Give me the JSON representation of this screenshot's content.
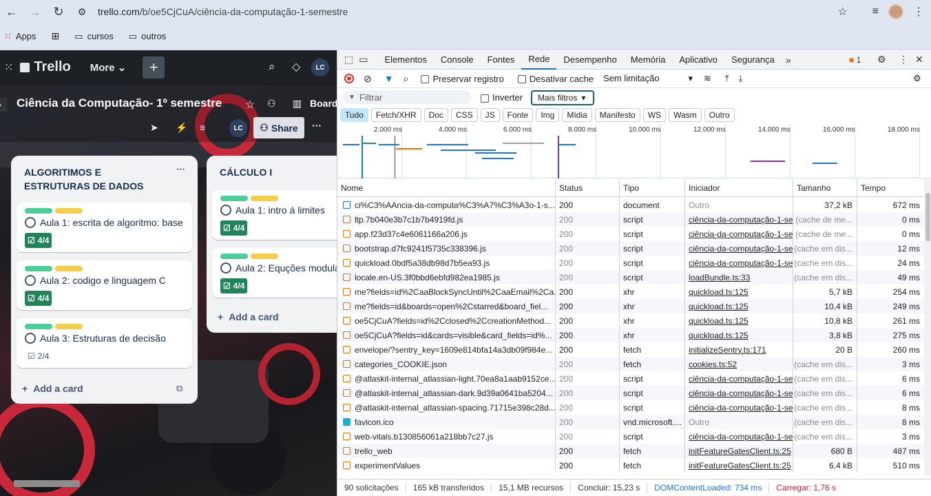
{
  "browser": {
    "url_host": "trello.com",
    "url_path": "/b/oe5CjCuA/ciência-da-computação-1-semestre",
    "bookmarks": [
      {
        "label": "Apps"
      },
      {
        "label": ""
      },
      {
        "label": "cursos"
      },
      {
        "label": "outros"
      }
    ]
  },
  "trello": {
    "brand": "Trello",
    "more": "More",
    "avatar": "LC",
    "board_title": "Ciência da Computação- 1º semestre",
    "board_view": "Board",
    "share": "Share",
    "lists": [
      {
        "title": "ALGORITIMOS E ESTRUTURAS DE DADOS",
        "add": "Add a card",
        "cards": [
          {
            "text": "Aula 1: escrita de algoritmo: base",
            "badge": "4/4",
            "complete": true
          },
          {
            "text": "Aula 2: codigo e linguagem C",
            "badge": "4/4",
            "complete": true
          },
          {
            "text": "Aula 3: Estruturas de decisão",
            "badge": "2/4",
            "complete": false
          }
        ]
      },
      {
        "title": "CÁLCULO I",
        "add": "Add a card",
        "cards": [
          {
            "text": "Aula 1: intro á limites",
            "badge": "4/4",
            "complete": true
          },
          {
            "text": "Aula 2: Equções modula",
            "badge": "4/4",
            "complete": true
          }
        ]
      }
    ],
    "colors": {
      "green_label": "#4bce97",
      "yellow_label": "#f5cd47",
      "badge_green": "#1f845a"
    }
  },
  "devtools": {
    "tabs": [
      "Elementos",
      "Console",
      "Fontes",
      "Rede",
      "Desempenho",
      "Memória",
      "Aplicativo",
      "Segurança"
    ],
    "active_tab": "Rede",
    "issues_count": "1",
    "toolbar": {
      "preserve": "Preservar registro",
      "disable_cache": "Desativar cache",
      "throttle": "Sem limitação"
    },
    "filter": {
      "placeholder": "Filtrar",
      "invert": "Inverter",
      "more_filters": "Mais filtros"
    },
    "types": [
      "Tudo",
      "Fetch/XHR",
      "Doc",
      "CSS",
      "JS",
      "Fonte",
      "Img",
      "Mídia",
      "Manifesto",
      "WS",
      "Wasm",
      "Outro"
    ],
    "timeline_labels": [
      "2.000 ms",
      "4.000 ms",
      "6.000 ms",
      "8.000 ms",
      "10.000 ms",
      "12.000 ms",
      "14.000 ms",
      "16.000 ms",
      "18.000 ms"
    ],
    "columns": [
      "Nome",
      "Status",
      "Tipo",
      "Iniciador",
      "Tamanho",
      "Tempo"
    ],
    "rows": [
      {
        "name": "ci%C3%AAncia-da-computa%C3%A7%C3%A3o-1-s...",
        "status": "200",
        "type": "document",
        "initiator": "Outro",
        "size": "37,2 kB",
        "time": "672 ms",
        "kind": "doc"
      },
      {
        "name": "ltp.7b040e3b7c1b7b4919fd.js",
        "status": "200",
        "type": "script",
        "initiator": "ciência-da-computação-1-se",
        "size": "(cache de me...",
        "time": "0 ms",
        "kind": "script"
      },
      {
        "name": "app.f23d37c4e6061166a206.js",
        "status": "200",
        "type": "script",
        "initiator": "ciência-da-computação-1-se",
        "size": "(cache de me...",
        "time": "0 ms",
        "kind": "script"
      },
      {
        "name": "bootstrap.d7fc9241f5735c338396.js",
        "status": "200",
        "type": "script",
        "initiator": "ciência-da-computação-1-se",
        "size": "(cache em dis...",
        "time": "12 ms",
        "kind": "script"
      },
      {
        "name": "quickload.0bdf5a38db98d7b5ea93.js",
        "status": "200",
        "type": "script",
        "initiator": "ciência-da-computação-1-se",
        "size": "(cache em dis...",
        "time": "24 ms",
        "kind": "script"
      },
      {
        "name": "locale.en-US.3f0bbd6ebfd982ea1985.js",
        "status": "200",
        "type": "script",
        "initiator": "loadBundle.ts:33",
        "size": "(cache em dis...",
        "time": "49 ms",
        "kind": "script"
      },
      {
        "name": "me?fields=id%2CaaBlockSyncUntil%2CaaEmail%2Ca...",
        "status": "200",
        "type": "xhr",
        "initiator": "quickload.ts:125",
        "size": "5,7 kB",
        "time": "254 ms",
        "kind": "xhr"
      },
      {
        "name": "me?fields=id&boards=open%2Cstarred&board_fiel...",
        "status": "200",
        "type": "xhr",
        "initiator": "quickload.ts:125",
        "size": "10,4 kB",
        "time": "249 ms",
        "kind": "xhr"
      },
      {
        "name": "oe5CjCuA?fields=id%2Cclosed%2CcreationMethod...",
        "status": "200",
        "type": "xhr",
        "initiator": "quickload.ts:125",
        "size": "10,8 kB",
        "time": "261 ms",
        "kind": "xhr"
      },
      {
        "name": "oe5CjCuA?fields=id&cards=visible&card_fields=id%...",
        "status": "200",
        "type": "xhr",
        "initiator": "quickload.ts:125",
        "size": "3,8 kB",
        "time": "275 ms",
        "kind": "xhr"
      },
      {
        "name": "envelope/?sentry_key=1609e814bfa14a3db09f984e...",
        "status": "200",
        "type": "fetch",
        "initiator": "initializeSentry.ts:171",
        "size": "20 B",
        "time": "260 ms",
        "kind": "xhr"
      },
      {
        "name": "categories_COOKIE.json",
        "status": "200",
        "type": "fetch",
        "initiator": "cookies.ts:52",
        "size": "(cache em dis...",
        "time": "3 ms",
        "kind": "xhr"
      },
      {
        "name": "@atlaskit-internal_atlassian-light.70ea8a1aab9152ce...",
        "status": "200",
        "type": "script",
        "initiator": "ciência-da-computação-1-se",
        "size": "(cache em dis...",
        "time": "6 ms",
        "kind": "script"
      },
      {
        "name": "@atlaskit-internal_atlassian-dark.9d39a0641ba5204...",
        "status": "200",
        "type": "script",
        "initiator": "ciência-da-computação-1-se",
        "size": "(cache em dis...",
        "time": "6 ms",
        "kind": "script"
      },
      {
        "name": "@atlaskit-internal_atlassian-spacing.71715e398c28d...",
        "status": "200",
        "type": "script",
        "initiator": "ciência-da-computação-1-se",
        "size": "(cache em dis...",
        "time": "8 ms",
        "kind": "script"
      },
      {
        "name": "favicon.ico",
        "status": "200",
        "type": "vnd.microsoft....",
        "initiator": "Outro",
        "size": "(cache em dis...",
        "time": "8 ms",
        "kind": "img"
      },
      {
        "name": "web-vitals.b130856061a218bb7c27.js",
        "status": "200",
        "type": "script",
        "initiator": "ciência-da-computação-1-se",
        "size": "(cache em dis...",
        "time": "3 ms",
        "kind": "script"
      },
      {
        "name": "trello_web",
        "status": "200",
        "type": "fetch",
        "initiator": "initFeatureGatesClient.ts:25",
        "size": "680 B",
        "time": "487 ms",
        "kind": "xhr"
      },
      {
        "name": "experimentValues",
        "status": "200",
        "type": "fetch",
        "initiator": "initFeatureGatesClient.ts:25",
        "size": "6,4 kB",
        "time": "510 ms",
        "kind": "xhr"
      }
    ],
    "status_bar": [
      "90 solicitações",
      "165 kB transferidos",
      "15,1 MB recursos",
      "Concluir: 15,23 s",
      "DOMContentLoaded: 734 ms",
      "Carregar: 1,76 s"
    ],
    "colors": {
      "dcl": "#1a73e8",
      "load": "#c5221f",
      "accent": "#1a73e8"
    }
  }
}
